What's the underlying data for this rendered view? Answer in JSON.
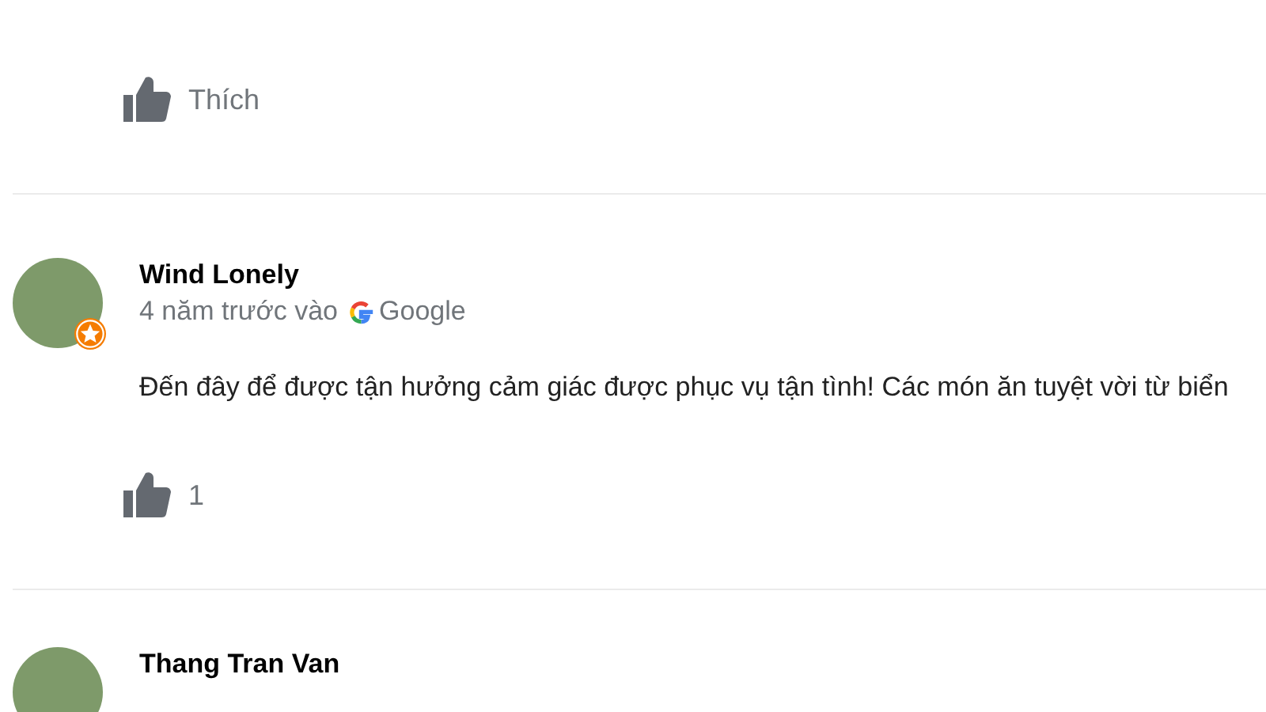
{
  "reviews": [
    {
      "like": {
        "label": "Thích"
      }
    },
    {
      "author": "Wind Lonely",
      "local_guide": true,
      "time": "4 năm trước vào",
      "source": "Google",
      "text": "Đến đây để được tận hưởng cảm giác được phục vụ tận tình! Các món ăn tuyệt vời từ biển",
      "like": {
        "label": "1"
      }
    },
    {
      "author": "Thang Tran Van"
    }
  ]
}
